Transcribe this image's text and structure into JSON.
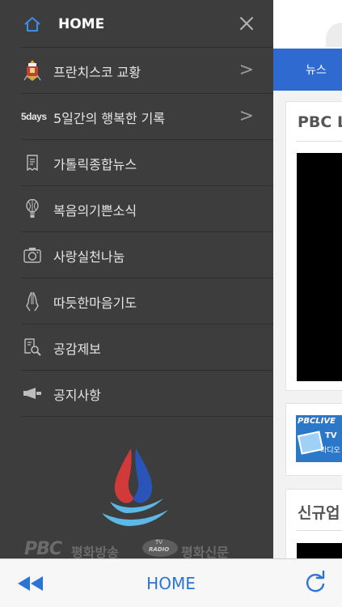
{
  "menu": {
    "home_label": "HOME",
    "items": [
      {
        "label": "프란치스코 교황",
        "icon": "pope-icon",
        "has_chevron": true
      },
      {
        "label": "5일간의 행복한 기록",
        "icon": "5days-icon",
        "icon_text": "5days",
        "has_chevron": true
      },
      {
        "label": "가톨릭종합뉴스",
        "icon": "document-icon",
        "has_chevron": false
      },
      {
        "label": "복음의기쁜소식",
        "icon": "balloon-icon",
        "has_chevron": false
      },
      {
        "label": "사랑실천나눔",
        "icon": "camera-icon",
        "has_chevron": false
      },
      {
        "label": "따듯한마음기도",
        "icon": "praying-hands-icon",
        "has_chevron": false
      },
      {
        "label": "공감제보",
        "icon": "search-document-icon",
        "has_chevron": false
      },
      {
        "label": "공지사항",
        "icon": "megaphone-icon",
        "has_chevron": false
      }
    ],
    "chevron": ">",
    "footer": {
      "pbc": "PBC",
      "name_broadcast": "평화방송",
      "tv": "TV",
      "radio": "RADIO",
      "name_paper": "평화신문"
    }
  },
  "content": {
    "tab_label": "뉴스",
    "card1_title": "PBC L",
    "card2_banner_top": "PBCLIVE",
    "card2_banner_right": "TV",
    "card2_banner_sub": "라디오",
    "card3_title": "신규업"
  },
  "toolbar": {
    "title": "HOME"
  },
  "colors": {
    "menu_bg": "#3d3d3d",
    "accent_blue": "#2b74d6",
    "tab_blue": "#2f6ad1",
    "home_icon": "#3c8ee8"
  }
}
